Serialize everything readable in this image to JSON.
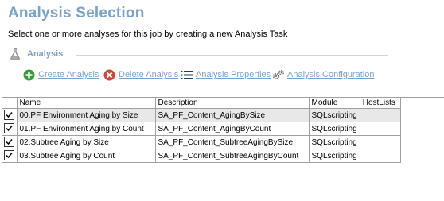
{
  "header": {
    "title": "Analysis Selection",
    "subtitle": "Select one or more analyses for this job by creating a new Analysis Task"
  },
  "section": {
    "label": "Analysis",
    "icon": "flask-icon"
  },
  "toolbar": {
    "items": [
      {
        "label": "Create Analysis",
        "icon": "plus-circle-icon",
        "color": "#3a9a3a"
      },
      {
        "label": "Delete Analysis",
        "icon": "delete-x-icon",
        "color": "#d0463b"
      },
      {
        "label": "Analysis Properties",
        "icon": "list-icon",
        "color": "#1f3f66"
      },
      {
        "label": "Analysis Configuration",
        "icon": "gears-icon",
        "color": "#7a7a7a"
      }
    ]
  },
  "table": {
    "columns": [
      "",
      "Name",
      "Description",
      "Module",
      "HostLists"
    ],
    "rows": [
      {
        "checked": true,
        "name": "00.PF Environment Aging by Size",
        "description": "SA_PF_Content_AgingBySize",
        "module": "SQLscripting",
        "hostlists": ""
      },
      {
        "checked": true,
        "name": "01.PF Environment Aging by Count",
        "description": "SA_PF_Content_AgingByCount",
        "module": "SQLscripting",
        "hostlists": ""
      },
      {
        "checked": true,
        "name": "02.Subtree Aging by Size",
        "description": "SA_PF_Content_SubtreeAgingBySize",
        "module": "SQLscripting",
        "hostlists": ""
      },
      {
        "checked": true,
        "name": "03.Subtree Aging by Count",
        "description": "SA_PF_Content_SubtreeAgingByCount",
        "module": "SQLscripting",
        "hostlists": ""
      }
    ]
  },
  "colors": {
    "accent": "#7aa3c9",
    "grid_line": "#a0a0a0",
    "row_shade": "#e8e8e8"
  }
}
